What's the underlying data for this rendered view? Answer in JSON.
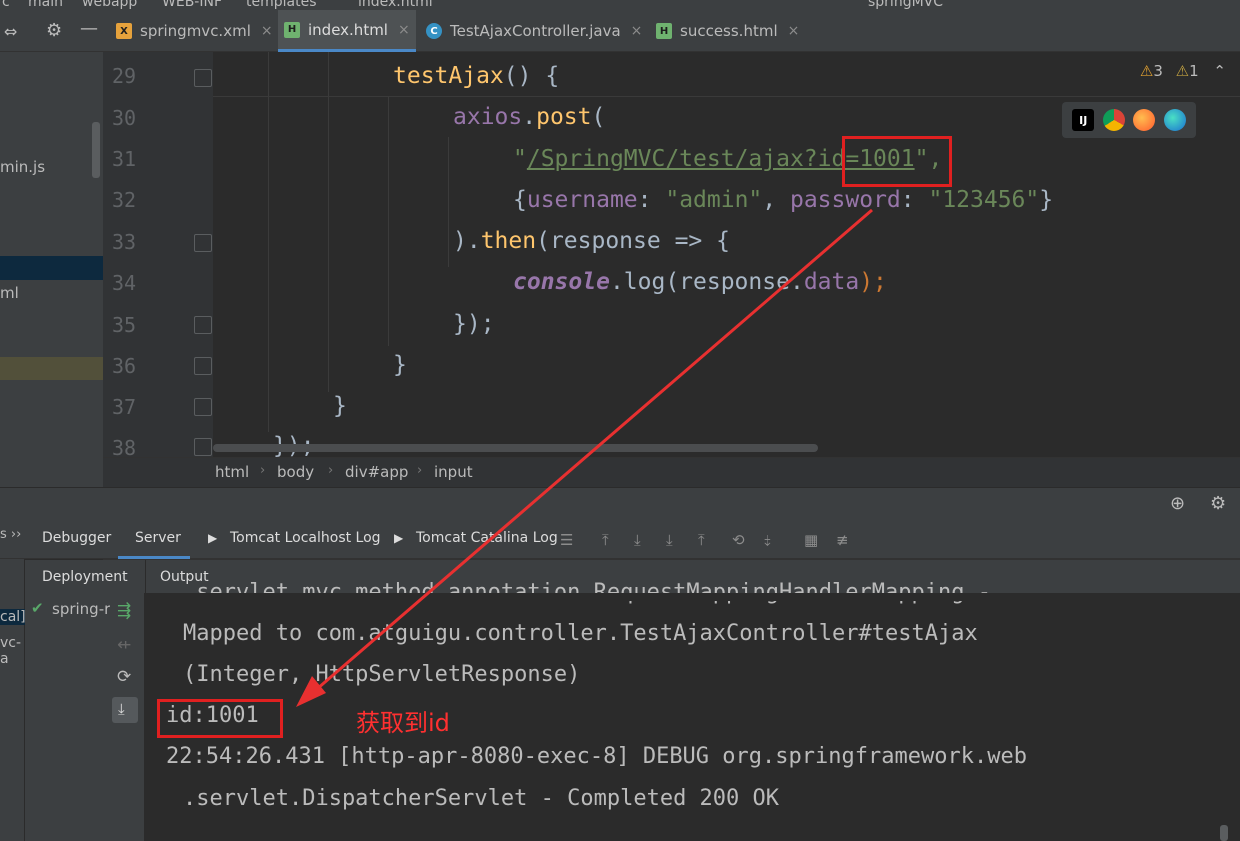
{
  "breadcrumb_top": [
    "c",
    "main",
    "webapp",
    "WEB-INF",
    "templates",
    "index.html"
  ],
  "run_config": "springMVC",
  "tabs": [
    {
      "label": "springmvc.xml",
      "icon": "xml-file-icon"
    },
    {
      "label": "index.html",
      "icon": "html-file-icon"
    },
    {
      "label": "TestAjaxController.java",
      "icon": "java-class-icon"
    },
    {
      "label": "success.html",
      "icon": "html-file-icon"
    }
  ],
  "project_panel": {
    "item1": "min.js",
    "item2": "ml"
  },
  "editor": {
    "line_numbers": [
      "29",
      "30",
      "31",
      "32",
      "33",
      "34",
      "35",
      "36",
      "37",
      "38"
    ],
    "l29_fn": "testAjax",
    "l29_rest": "() {",
    "l30_obj": "axios",
    "l30_dot": ".",
    "l30_fn": "post",
    "l30_paren": "(",
    "l31_q1": "\"",
    "l31_url": "/SpringMVC/test/ajax?id=1001",
    "l31_q2": "\",",
    "l32_open": "{",
    "l32_k1": "username",
    "l32_c1": ": ",
    "l32_v1": "\"admin\"",
    "l32_comma": ", ",
    "l32_k2": "password",
    "l32_c2": ": ",
    "l32_v2": "\"123456\"",
    "l32_close": "}",
    "l33_a": ").",
    "l33_fn": "then",
    "l33_b": "(response => {",
    "l34_console": "console",
    "l34_rest": ".log(response.",
    "l34_data": "data",
    "l34_end": ");",
    "l35": "});",
    "l36": "}",
    "l37": "}",
    "l38": "});"
  },
  "warnings": {
    "warn_count": "3",
    "weak_count": "1"
  },
  "path_crumbs": [
    "html",
    "body",
    "div#app",
    "input"
  ],
  "bottom_tabs": {
    "debugger": "Debugger",
    "server": "Server",
    "localhost_log": "Tomcat Localhost Log",
    "catalina_log": "Tomcat Catalina Log"
  },
  "deployment": {
    "header": "Deployment",
    "output_header": "Output",
    "item": "spring-r",
    "left_cut1": "cal]",
    "left_cut2": "vc-a"
  },
  "output_lines": [
    ".servlet.mvc.method.annotation.RequestMappingHandlerMapping -",
    "Mapped to com.atguigu.controller.TestAjaxController#testAjax",
    "(Integer, HttpServletResponse)",
    "id:1001",
    "22:54:26.431 [http-apr-8080-exec-8] DEBUG org.springframework.web",
    ".servlet.DispatcherServlet - Completed 200 OK"
  ],
  "annotation": "获取到id",
  "colors": {
    "annotation_red": "#e02020",
    "keyword": "#cc7832",
    "function": "#ffc66d",
    "string": "#6a8759",
    "property": "#9876aa"
  }
}
